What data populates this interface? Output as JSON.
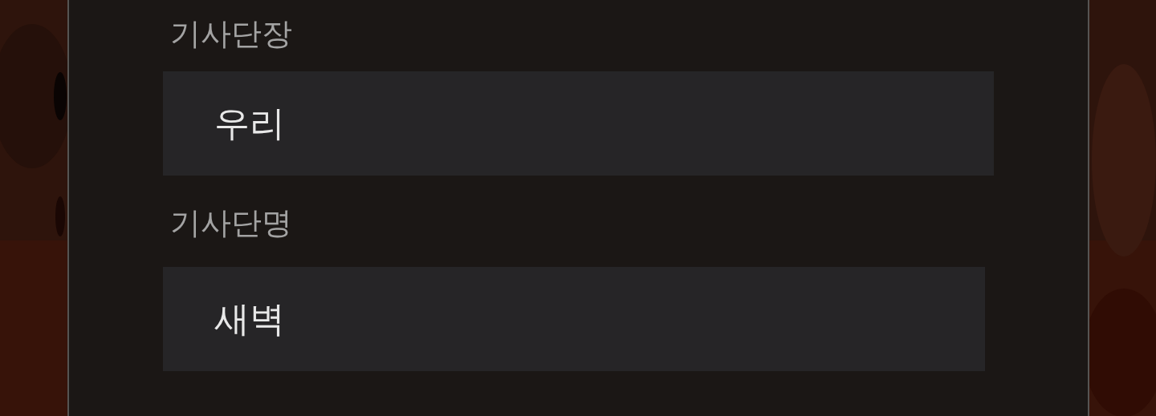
{
  "fields": [
    {
      "label": "기사단장",
      "value": "우리"
    },
    {
      "label": "기사단명",
      "value": "새벽"
    }
  ]
}
